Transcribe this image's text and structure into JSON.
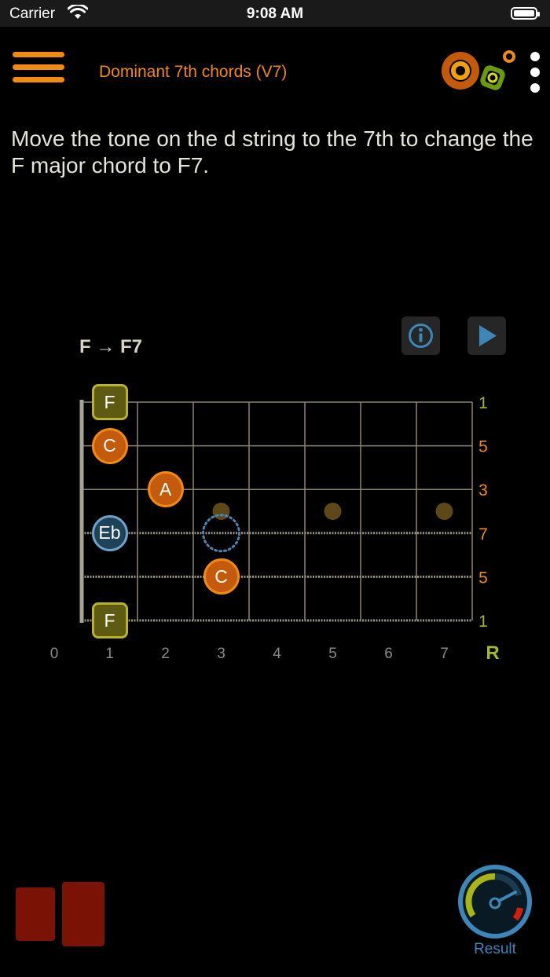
{
  "status_bar": {
    "carrier": "Carrier",
    "time": "9:08 AM"
  },
  "header": {
    "title": "Dominant 7th chords (V7)",
    "menu_icon": "hamburger-menu-icon",
    "more_icon": "vertical-ellipsis-icon"
  },
  "instruction": "Move the tone on the d string to the 7th to change the F major chord to F7.",
  "chord": {
    "label": "F → F7"
  },
  "buttons": {
    "info_icon": "info-icon",
    "play_icon": "play-icon"
  },
  "fretboard": {
    "fret_numbers": [
      "0",
      "1",
      "2",
      "3",
      "4",
      "5",
      "6",
      "7"
    ],
    "interval_header": "R",
    "string_intervals": [
      "1",
      "5",
      "3",
      "7",
      "5",
      "1"
    ],
    "notes": [
      {
        "label": "F",
        "string": 1,
        "fret": 1,
        "style": "root"
      },
      {
        "label": "C",
        "string": 2,
        "fret": 1,
        "style": "orange"
      },
      {
        "label": "A",
        "string": 3,
        "fret": 2,
        "style": "orange"
      },
      {
        "label": "Eb",
        "string": 4,
        "fret": 1,
        "style": "blue"
      },
      {
        "label": "C",
        "string": 5,
        "fret": 3,
        "style": "orange"
      },
      {
        "label": "F",
        "string": 6,
        "fret": 1,
        "style": "root"
      }
    ],
    "target_marker": {
      "string": 4,
      "fret": 3
    },
    "inlay_frets": [
      3,
      5,
      7
    ],
    "colors": {
      "orange": "#f28a10",
      "root": "#b6b425",
      "blue": "#6da3c9",
      "interval_root": "#9fb82a",
      "fret_line": "#8a8470"
    }
  },
  "result": {
    "label": "Result",
    "icon": "result-gauge-icon"
  }
}
